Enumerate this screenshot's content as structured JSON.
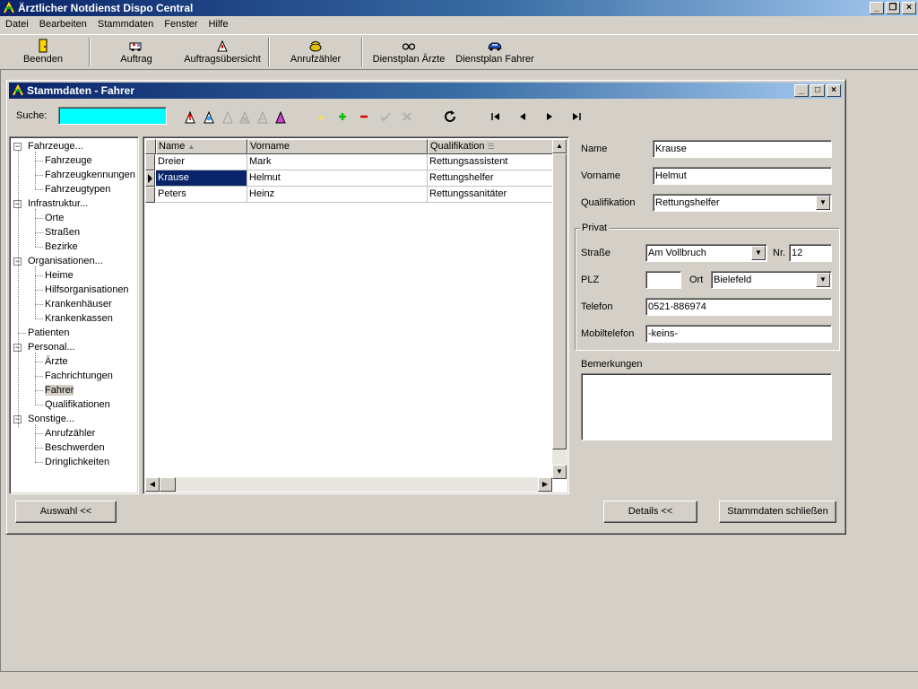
{
  "window": {
    "title": "Ärztlicher Notdienst Dispo Central",
    "min": "_",
    "restore": "❐",
    "close": "×"
  },
  "menu": [
    "Datei",
    "Bearbeiten",
    "Stammdaten",
    "Fenster",
    "Hilfe"
  ],
  "toolbar": [
    {
      "label": "Beenden",
      "icon": "exit-door-icon"
    },
    {
      "label": "Auftrag",
      "icon": "ambulance-icon"
    },
    {
      "label": "Auftragsübersicht",
      "icon": "order-overview-icon"
    },
    {
      "label": "Anrufzähler",
      "icon": "phone-icon"
    },
    {
      "label": "Dienstplan Ärzte",
      "icon": "glasses-icon"
    },
    {
      "label": "Dienstplan Fahrer",
      "icon": "car-icon"
    }
  ],
  "child": {
    "title": "Stammdaten - Fahrer",
    "search_label": "Suche:",
    "search_value": ""
  },
  "tree": [
    {
      "label": "Fahrzeuge...",
      "level": 0,
      "expanded": true
    },
    {
      "label": "Fahrzeuge",
      "level": 1
    },
    {
      "label": "Fahrzeugkennungen",
      "level": 1
    },
    {
      "label": "Fahrzeugtypen",
      "level": 1
    },
    {
      "label": "Infrastruktur...",
      "level": 0,
      "expanded": true
    },
    {
      "label": "Orte",
      "level": 1
    },
    {
      "label": "Straßen",
      "level": 1
    },
    {
      "label": "Bezirke",
      "level": 1
    },
    {
      "label": "Organisationen...",
      "level": 0,
      "expanded": true
    },
    {
      "label": "Heime",
      "level": 1
    },
    {
      "label": "Hilfsorganisationen",
      "level": 1
    },
    {
      "label": "Krankenhäuser",
      "level": 1
    },
    {
      "label": "Krankenkassen",
      "level": 1
    },
    {
      "label": "Patienten",
      "level": 0
    },
    {
      "label": "Personal...",
      "level": 0,
      "expanded": true
    },
    {
      "label": "Ärzte",
      "level": 1
    },
    {
      "label": "Fachrichtungen",
      "level": 1
    },
    {
      "label": "Fahrer",
      "level": 1,
      "selected": true
    },
    {
      "label": "Qualifikationen",
      "level": 1
    },
    {
      "label": "Sonstige...",
      "level": 0,
      "expanded": true
    },
    {
      "label": "Anrufzähler",
      "level": 1
    },
    {
      "label": "Beschwerden",
      "level": 1
    },
    {
      "label": "Dringlichkeiten",
      "level": 1
    }
  ],
  "grid": {
    "columns": [
      "Name",
      "Vorname",
      "Qualifikation"
    ],
    "rows": [
      [
        "Dreier",
        "Mark",
        "Rettungsassistent"
      ],
      [
        "Krause",
        "Helmut",
        "Rettungshelfer"
      ],
      [
        "Peters",
        "Heinz",
        "Rettungssanitäter"
      ]
    ],
    "selected_row": 1
  },
  "detail": {
    "name_label": "Name",
    "name": "Krause",
    "vorname_label": "Vorname",
    "vorname": "Helmut",
    "qual_label": "Qualifikation",
    "qual": "Rettungshelfer",
    "privat_label": "Privat",
    "strasse_label": "Straße",
    "strasse": "Am Vollbruch",
    "nr_label": "Nr.",
    "nr": "12",
    "plz_label": "PLZ",
    "plz": "",
    "ort_label": "Ort",
    "ort": "Bielefeld",
    "telefon_label": "Telefon",
    "telefon": "0521-886974",
    "mobil_label": "Mobiltelefon",
    "mobil": "-keins-",
    "bemerkungen_label": "Bemerkungen",
    "bemerkungen": ""
  },
  "buttons": {
    "auswahl": "Auswahl <<",
    "details": "Details <<",
    "close": "Stammdaten schließen"
  },
  "colors": {
    "title_active": "#0a246a",
    "search_bg": "#00ffff",
    "selection": "#0a246a"
  }
}
